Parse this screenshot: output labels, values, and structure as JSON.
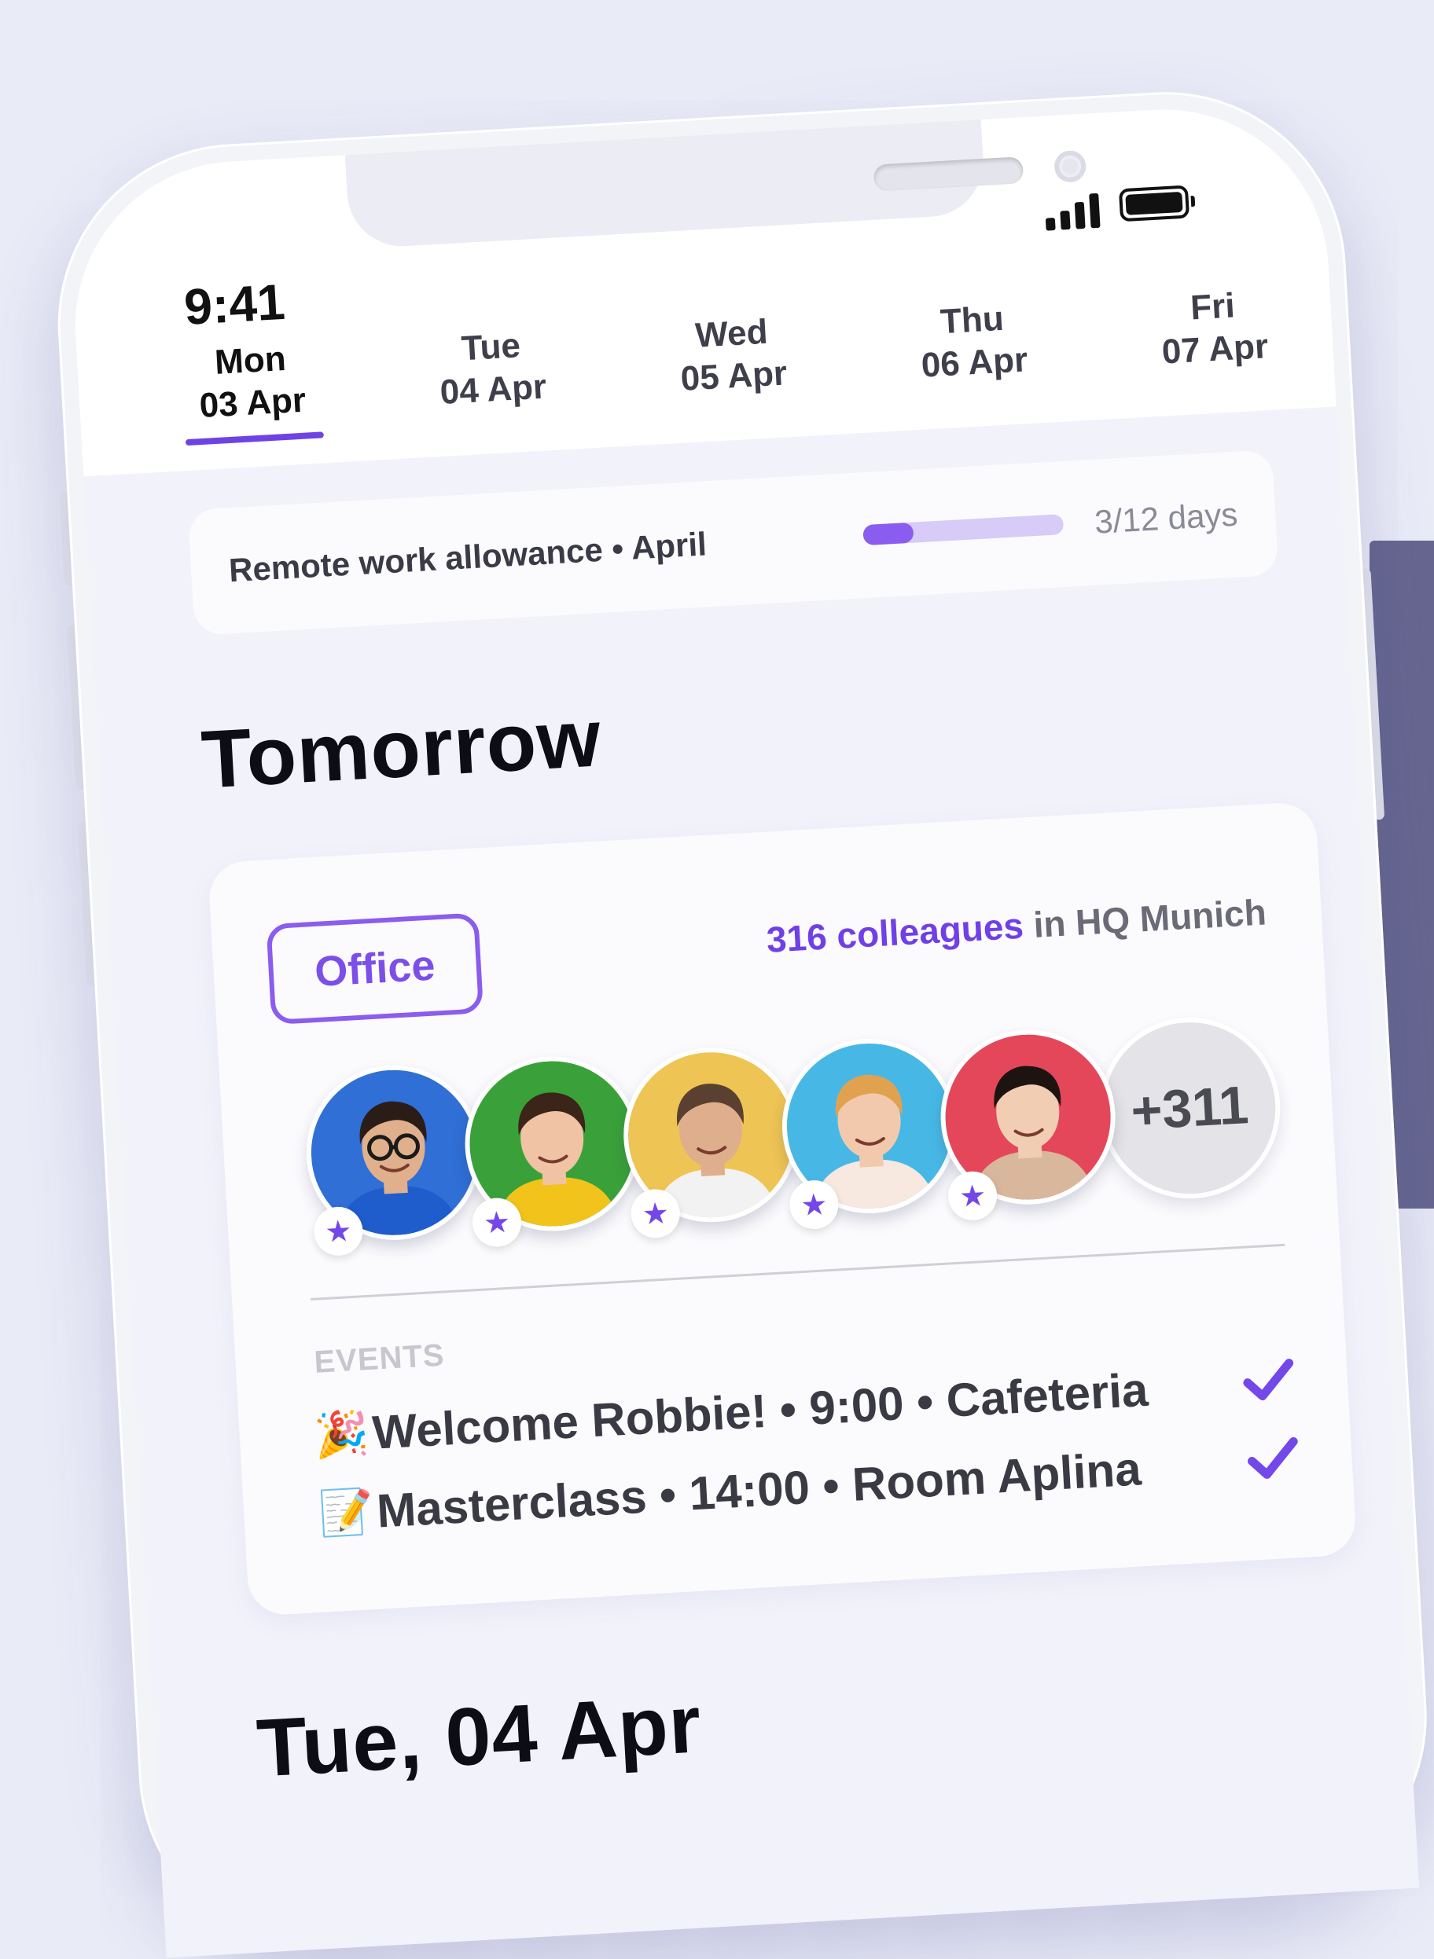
{
  "status_bar": {
    "time": "9:41"
  },
  "week": {
    "days": [
      {
        "name": "Mon",
        "date": "03 Apr",
        "selected": true
      },
      {
        "name": "Tue",
        "date": "04 Apr",
        "selected": false
      },
      {
        "name": "Wed",
        "date": "05 Apr",
        "selected": false
      },
      {
        "name": "Thu",
        "date": "06 Apr",
        "selected": false
      },
      {
        "name": "Fri",
        "date": "07 Apr",
        "selected": false
      }
    ]
  },
  "allowance": {
    "label": "Remote work allowance • April",
    "used": 3,
    "total": 12,
    "text": "3/12 days"
  },
  "tomorrow": {
    "title": "Tomorrow",
    "location_type": "Office",
    "colleagues_count_text": "316 colleagues",
    "colleagues_suffix": " in HQ Munich",
    "avatars": [
      {
        "name": "colleague-1",
        "bg": "#2f6fd6",
        "shirt": "#1f5ccc",
        "skin": "#e0b08c",
        "hair": "#2a1d18",
        "glasses": true
      },
      {
        "name": "colleague-2",
        "bg": "#3aa13a",
        "shirt": "#f2c31b",
        "skin": "#f0c3a4",
        "hair": "#3b2418",
        "glasses": false
      },
      {
        "name": "colleague-3",
        "bg": "#eec454",
        "shirt": "#f2f2f2",
        "skin": "#dfae8c",
        "hair": "#5a4030",
        "glasses": false
      },
      {
        "name": "colleague-4",
        "bg": "#47b8e6",
        "shirt": "#f7e8e0",
        "skin": "#f3c9ad",
        "hair": "#e0a24e",
        "glasses": false
      },
      {
        "name": "colleague-5",
        "bg": "#e5475a",
        "shirt": "#d9b79c",
        "skin": "#f1cdb3",
        "hair": "#1d1412",
        "glasses": false
      }
    ],
    "more_text": "+311",
    "events_heading": "EVENTS",
    "events": [
      {
        "emoji": "🎉",
        "text": "Welcome Robbie! • 9:00 • Cafeteria",
        "checked": true
      },
      {
        "emoji": "📝",
        "text": "Masterclass • 14:00 • Room Aplina",
        "checked": true
      }
    ]
  },
  "next_section": {
    "title": "Tue, 04 Apr"
  },
  "colors": {
    "accent": "#7447e9",
    "accent_light": "#d8cbf7",
    "background": "#e9ebf7",
    "side_panel": "#666690"
  },
  "icons": [
    "signal-icon",
    "battery-icon",
    "star-icon",
    "checkmark-icon",
    "party-popper-icon",
    "memo-icon"
  ]
}
